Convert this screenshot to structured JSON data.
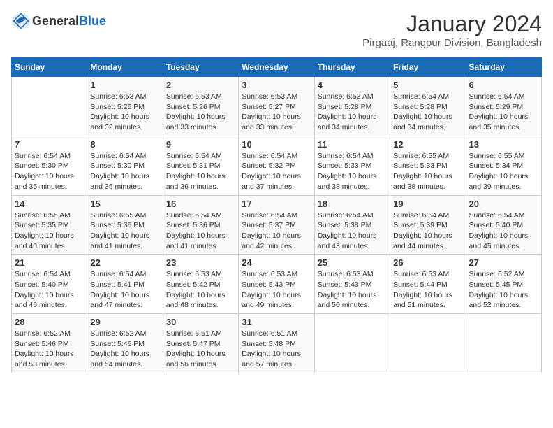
{
  "header": {
    "logo_general": "General",
    "logo_blue": "Blue",
    "month_title": "January 2024",
    "location": "Pirgaaj, Rangpur Division, Bangladesh"
  },
  "days_of_week": [
    "Sunday",
    "Monday",
    "Tuesday",
    "Wednesday",
    "Thursday",
    "Friday",
    "Saturday"
  ],
  "weeks": [
    [
      {
        "day": "",
        "info": ""
      },
      {
        "day": "1",
        "info": "Sunrise: 6:53 AM\nSunset: 5:26 PM\nDaylight: 10 hours\nand 32 minutes."
      },
      {
        "day": "2",
        "info": "Sunrise: 6:53 AM\nSunset: 5:26 PM\nDaylight: 10 hours\nand 33 minutes."
      },
      {
        "day": "3",
        "info": "Sunrise: 6:53 AM\nSunset: 5:27 PM\nDaylight: 10 hours\nand 33 minutes."
      },
      {
        "day": "4",
        "info": "Sunrise: 6:53 AM\nSunset: 5:28 PM\nDaylight: 10 hours\nand 34 minutes."
      },
      {
        "day": "5",
        "info": "Sunrise: 6:54 AM\nSunset: 5:28 PM\nDaylight: 10 hours\nand 34 minutes."
      },
      {
        "day": "6",
        "info": "Sunrise: 6:54 AM\nSunset: 5:29 PM\nDaylight: 10 hours\nand 35 minutes."
      }
    ],
    [
      {
        "day": "7",
        "info": "Sunrise: 6:54 AM\nSunset: 5:30 PM\nDaylight: 10 hours\nand 35 minutes."
      },
      {
        "day": "8",
        "info": "Sunrise: 6:54 AM\nSunset: 5:30 PM\nDaylight: 10 hours\nand 36 minutes."
      },
      {
        "day": "9",
        "info": "Sunrise: 6:54 AM\nSunset: 5:31 PM\nDaylight: 10 hours\nand 36 minutes."
      },
      {
        "day": "10",
        "info": "Sunrise: 6:54 AM\nSunset: 5:32 PM\nDaylight: 10 hours\nand 37 minutes."
      },
      {
        "day": "11",
        "info": "Sunrise: 6:54 AM\nSunset: 5:33 PM\nDaylight: 10 hours\nand 38 minutes."
      },
      {
        "day": "12",
        "info": "Sunrise: 6:55 AM\nSunset: 5:33 PM\nDaylight: 10 hours\nand 38 minutes."
      },
      {
        "day": "13",
        "info": "Sunrise: 6:55 AM\nSunset: 5:34 PM\nDaylight: 10 hours\nand 39 minutes."
      }
    ],
    [
      {
        "day": "14",
        "info": "Sunrise: 6:55 AM\nSunset: 5:35 PM\nDaylight: 10 hours\nand 40 minutes."
      },
      {
        "day": "15",
        "info": "Sunrise: 6:55 AM\nSunset: 5:36 PM\nDaylight: 10 hours\nand 41 minutes."
      },
      {
        "day": "16",
        "info": "Sunrise: 6:54 AM\nSunset: 5:36 PM\nDaylight: 10 hours\nand 41 minutes."
      },
      {
        "day": "17",
        "info": "Sunrise: 6:54 AM\nSunset: 5:37 PM\nDaylight: 10 hours\nand 42 minutes."
      },
      {
        "day": "18",
        "info": "Sunrise: 6:54 AM\nSunset: 5:38 PM\nDaylight: 10 hours\nand 43 minutes."
      },
      {
        "day": "19",
        "info": "Sunrise: 6:54 AM\nSunset: 5:39 PM\nDaylight: 10 hours\nand 44 minutes."
      },
      {
        "day": "20",
        "info": "Sunrise: 6:54 AM\nSunset: 5:40 PM\nDaylight: 10 hours\nand 45 minutes."
      }
    ],
    [
      {
        "day": "21",
        "info": "Sunrise: 6:54 AM\nSunset: 5:40 PM\nDaylight: 10 hours\nand 46 minutes."
      },
      {
        "day": "22",
        "info": "Sunrise: 6:54 AM\nSunset: 5:41 PM\nDaylight: 10 hours\nand 47 minutes."
      },
      {
        "day": "23",
        "info": "Sunrise: 6:53 AM\nSunset: 5:42 PM\nDaylight: 10 hours\nand 48 minutes."
      },
      {
        "day": "24",
        "info": "Sunrise: 6:53 AM\nSunset: 5:43 PM\nDaylight: 10 hours\nand 49 minutes."
      },
      {
        "day": "25",
        "info": "Sunrise: 6:53 AM\nSunset: 5:43 PM\nDaylight: 10 hours\nand 50 minutes."
      },
      {
        "day": "26",
        "info": "Sunrise: 6:53 AM\nSunset: 5:44 PM\nDaylight: 10 hours\nand 51 minutes."
      },
      {
        "day": "27",
        "info": "Sunrise: 6:52 AM\nSunset: 5:45 PM\nDaylight: 10 hours\nand 52 minutes."
      }
    ],
    [
      {
        "day": "28",
        "info": "Sunrise: 6:52 AM\nSunset: 5:46 PM\nDaylight: 10 hours\nand 53 minutes."
      },
      {
        "day": "29",
        "info": "Sunrise: 6:52 AM\nSunset: 5:46 PM\nDaylight: 10 hours\nand 54 minutes."
      },
      {
        "day": "30",
        "info": "Sunrise: 6:51 AM\nSunset: 5:47 PM\nDaylight: 10 hours\nand 56 minutes."
      },
      {
        "day": "31",
        "info": "Sunrise: 6:51 AM\nSunset: 5:48 PM\nDaylight: 10 hours\nand 57 minutes."
      },
      {
        "day": "",
        "info": ""
      },
      {
        "day": "",
        "info": ""
      },
      {
        "day": "",
        "info": ""
      }
    ]
  ]
}
